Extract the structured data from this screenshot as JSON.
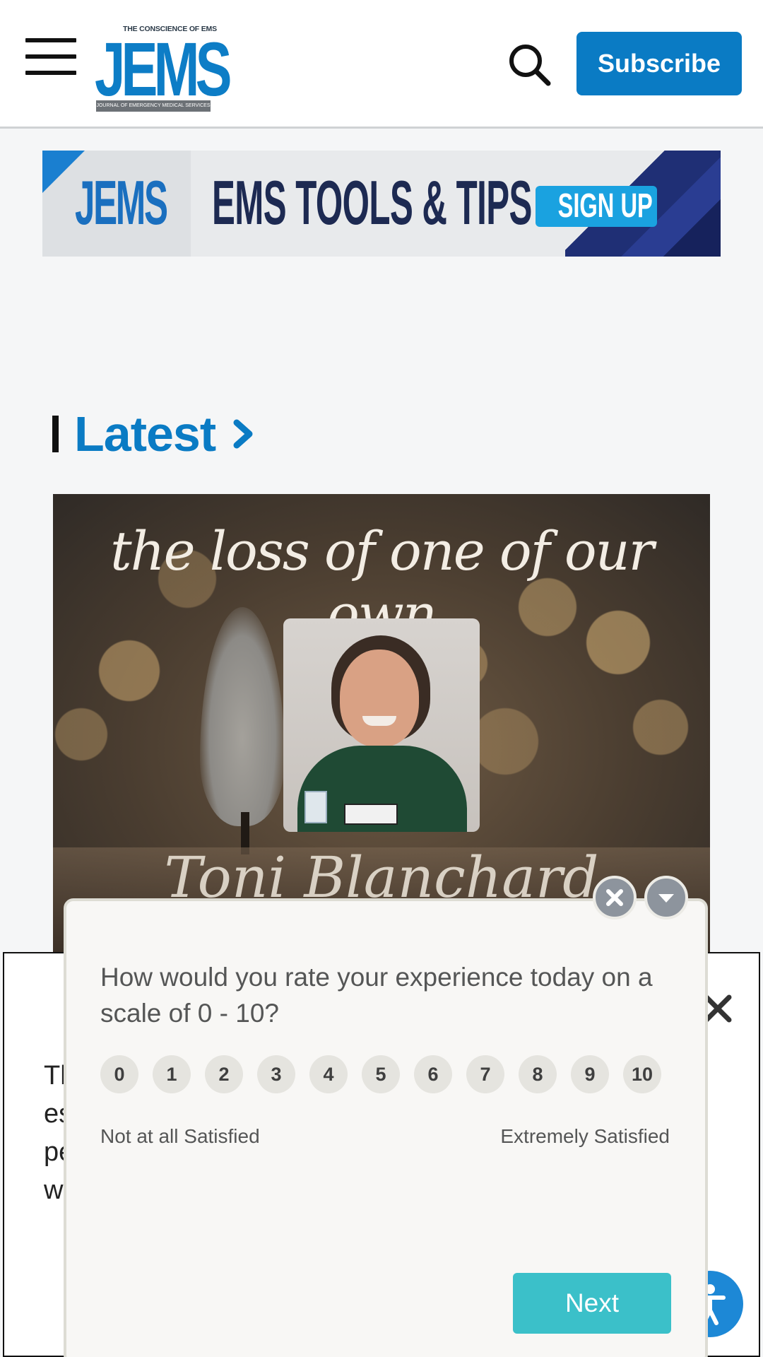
{
  "header": {
    "logo": {
      "tagline": "THE CONSCIENCE OF EMS",
      "wordmark": "JEMS",
      "subline": "JOURNAL OF EMERGENCY MEDICAL SERVICES"
    },
    "menu_icon": "hamburger-menu-icon",
    "search_icon": "magnifier-icon",
    "subscribe_label": "Subscribe",
    "accent_color": "#0a7bc4"
  },
  "banner_ad": {
    "logo_text": "JEMS",
    "headline": "EMS TOOLS & TIPS",
    "cta": "SIGN UP"
  },
  "section": {
    "title": "Latest",
    "chevron_icon": "chevron-right-icon"
  },
  "feature_image": {
    "heading": "the loss of one of our own",
    "name": "Toni Blanchard"
  },
  "notice": {
    "text": "Th\nes\npe\nw",
    "close_icon": "x-icon"
  },
  "survey": {
    "question": "How would you rate your experience today on a scale of 0 - 10?",
    "scale": [
      "0",
      "1",
      "2",
      "3",
      "4",
      "5",
      "6",
      "7",
      "8",
      "9",
      "10"
    ],
    "low_label": "Not at all Satisfied",
    "high_label": "Extremely Satisfied",
    "next_label": "Next",
    "close_icon": "x-circle-icon",
    "minimize_icon": "caret-down-icon",
    "button_color": "#3bc0c9"
  },
  "accessibility": {
    "icon": "accessibility-person-icon"
  }
}
